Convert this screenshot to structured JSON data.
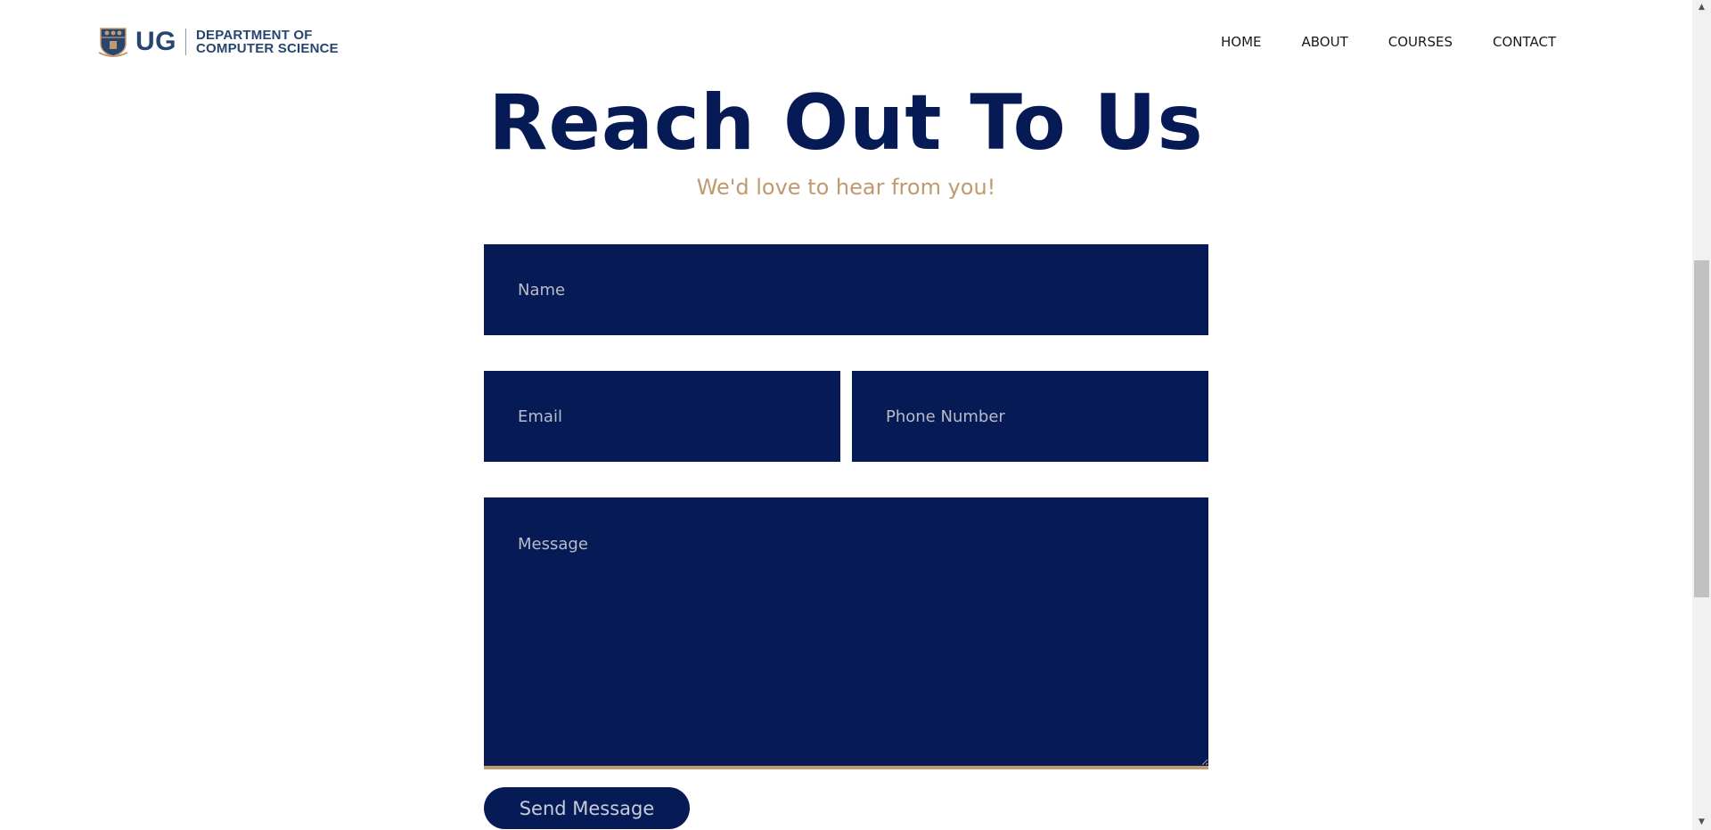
{
  "header": {
    "logo_short": "UG",
    "logo_line1": "DEPARTMENT OF",
    "logo_line2": "COMPUTER SCIENCE",
    "nav": [
      "HOME",
      "ABOUT",
      "COURSES",
      "CONTACT"
    ]
  },
  "main": {
    "title": "Reach Out To Us",
    "subtitle": "We'd love to hear from you!"
  },
  "form": {
    "name_placeholder": "Name",
    "email_placeholder": "Email",
    "phone_placeholder": "Phone Number",
    "message_placeholder": "Message",
    "send_label": "Send Message"
  },
  "colors": {
    "navy": "#061a55",
    "gold": "#c09a6e",
    "logo_blue": "#27456e"
  },
  "icons": {
    "crest": "university-crest-icon",
    "scroll_up": "arrow-up-icon",
    "scroll_down": "arrow-down-icon"
  }
}
